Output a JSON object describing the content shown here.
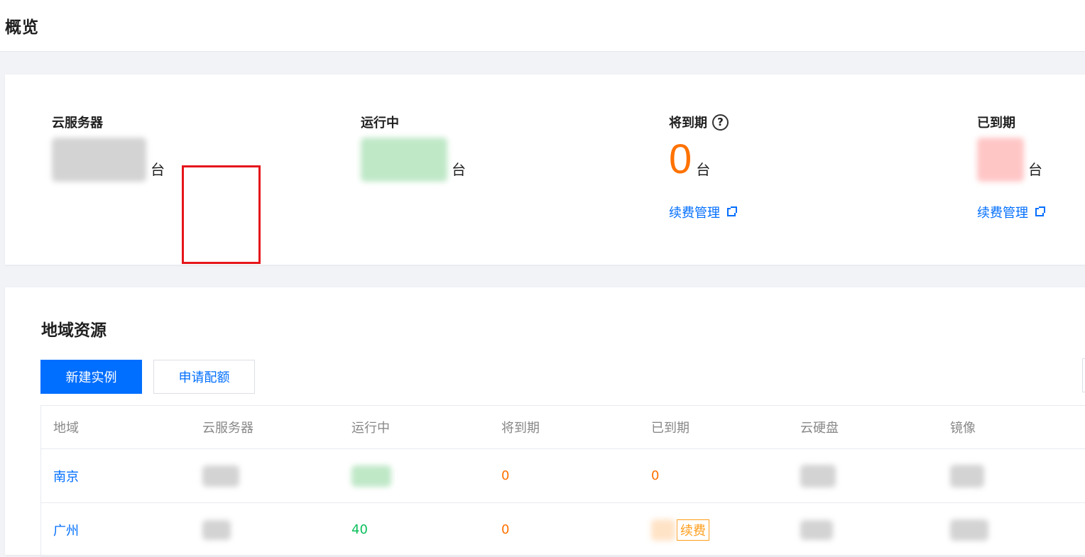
{
  "page": {
    "title": "概览"
  },
  "stats": {
    "servers_label": "云服务器",
    "running_label": "运行中",
    "expiring_label": "将到期",
    "expiring_value": "0",
    "expired_label": "已到期",
    "unit": "台",
    "renew_link": "续费管理",
    "help_icon": "?"
  },
  "region": {
    "title": "地域资源",
    "new_instance_button": "新建实例",
    "apply_quota_button": "申请配额",
    "columns": [
      "地域",
      "云服务器",
      "运行中",
      "将到期",
      "已到期",
      "云硬盘",
      "镜像"
    ],
    "rows": [
      {
        "region": "南京",
        "expiring": "0",
        "expired": "0"
      },
      {
        "region": "广州",
        "running": "40",
        "expiring": "0",
        "renew_tag": "续费"
      }
    ]
  },
  "colors": {
    "accent": "#006eff",
    "orange": "#ff7200",
    "green": "#0abf5b",
    "highlight": "#e5161b"
  }
}
